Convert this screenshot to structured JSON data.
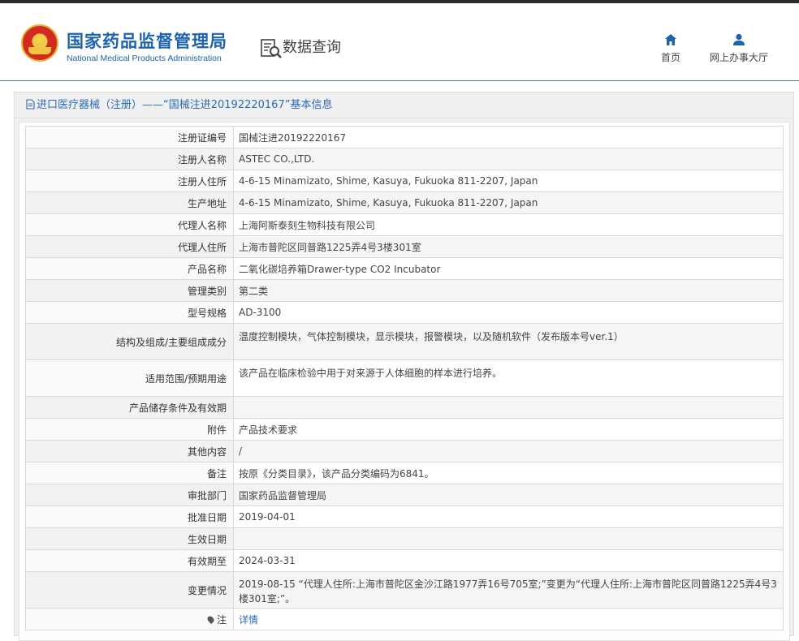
{
  "header": {
    "logo_cn": "国家药品监督管理局",
    "logo_en": "National Medical Products Administration",
    "query_title": "数据查询",
    "nav": [
      {
        "label": "首页",
        "icon": "home-icon"
      },
      {
        "label": "网上办事大厅",
        "icon": "user-icon"
      }
    ]
  },
  "panel": {
    "title": "进口医疗器械（注册）——“国械注进20192220167”基本信息"
  },
  "colors": {
    "brand_blue": "#1e63ad",
    "link_blue": "#2a6bb4",
    "emblem_red": "#d12a1f",
    "emblem_gold": "#f2c94c"
  },
  "rows": [
    {
      "label": "注册证编号",
      "value": "国械注进20192220167"
    },
    {
      "label": "注册人名称",
      "value": "ASTEC CO.,LTD."
    },
    {
      "label": "注册人住所",
      "value": "4-6-15 Minamizato, Shime, Kasuya, Fukuoka 811-2207, Japan"
    },
    {
      "label": "生产地址",
      "value": "4-6-15 Minamizato, Shime, Kasuya, Fukuoka 811-2207, Japan"
    },
    {
      "label": "代理人名称",
      "value": "上海阿斯泰刻生物科技有限公司"
    },
    {
      "label": "代理人住所",
      "value": "上海市普陀区同普路1225弄4号3楼301室"
    },
    {
      "label": "产品名称",
      "value": "二氧化碳培养箱Drawer-type CO2 Incubator"
    },
    {
      "label": "管理类别",
      "value": "第二类"
    },
    {
      "label": "型号规格",
      "value": "AD-3100"
    },
    {
      "label": "结构及组成/主要组成成分",
      "value": "温度控制模块，气体控制模块，显示模块，报警模块，以及随机软件（发布版本号ver.1）"
    },
    {
      "label": "适用范围/预期用途",
      "value": "该产品在临床检验中用于对来源于人体细胞的样本进行培养。"
    },
    {
      "label": "产品储存条件及有效期",
      "value": ""
    },
    {
      "label": "附件",
      "value": "产品技术要求"
    },
    {
      "label": "其他内容",
      "value": "/"
    },
    {
      "label": "备注",
      "value": "按原《分类目录》，该产品分类编码为6841。"
    },
    {
      "label": "审批部门",
      "value": "国家药品监督管理局"
    },
    {
      "label": "批准日期",
      "value": "2019-04-01"
    },
    {
      "label": "生效日期",
      "value": ""
    },
    {
      "label": "有效期至",
      "value": "2024-03-31"
    },
    {
      "label": "变更情况",
      "value": "2019-08-15 “代理人住所:上海市普陀区金沙江路1977弄16号705室;”变更为“代理人住所:上海市普陀区同普路1225弄4号3楼301室;”。"
    },
    {
      "label": "注",
      "value": "详情",
      "icon": "location-pin-icon"
    }
  ]
}
